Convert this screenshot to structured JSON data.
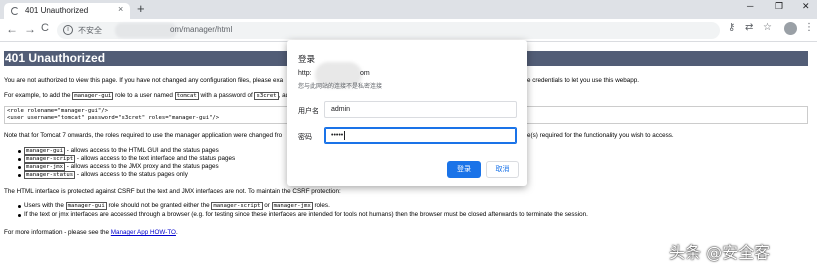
{
  "browser": {
    "tab_title": "401 Unauthorized",
    "tab_close": "×",
    "new_tab": "+",
    "window_controls": {
      "minimize": "─",
      "maximize": "❐",
      "close": "✕"
    },
    "nav": {
      "back": "←",
      "forward": "→",
      "reload": "C"
    },
    "address": {
      "security_label": "不安全",
      "url_visible": "om/manager/html"
    },
    "toolbar_icons": {
      "key": "⚷",
      "translate": "⇄",
      "star": "☆",
      "menu": "⋮"
    }
  },
  "page": {
    "heading": "401 Unauthorized",
    "para1": "You are not authorized to view this page. If you have not changed any configuration files, please exa",
    "para1_tail": "e credentials to let you use this webapp.",
    "para2_pre": "For example, to add the",
    "para2_code1": "manager-gui",
    "para2_mid": "role to a user named",
    "para2_code2": "tomcat",
    "para2_mid2": "with a password of",
    "para2_code3": "s3cret",
    "para2_post": ", add",
    "code_line1": "<role rolename=\"manager-gui\"/>",
    "code_line2": "<user username=\"tomcat\" password=\"s3cret\" roles=\"manager-gui\"/>",
    "para3": "Note that for Tomcat 7 onwards, the roles required to use the manager application were changed fro",
    "para3_tail": "e(s) required for the functionality you wish to access.",
    "roles": [
      {
        "code": "manager-gui",
        "text": "- allows access to the HTML GUI and the status pages"
      },
      {
        "code": "manager-script",
        "text": "- allows access to the text interface and the status pages"
      },
      {
        "code": "manager-jmx",
        "text": "- allows access to the JMX proxy and the status pages"
      },
      {
        "code": "manager-status",
        "text": "- allows access to the status pages only"
      }
    ],
    "para4": "The HTML interface is protected against CSRF but the text and JMX interfaces are not. To maintain the CSRF protection:",
    "csrf1_pre": "Users with the",
    "csrf1_code1": "manager-gui",
    "csrf1_mid": "role should not be granted either the",
    "csrf1_code2": "manager-script",
    "csrf1_or": "or",
    "csrf1_code3": "manager-jmx",
    "csrf1_post": "roles.",
    "csrf2": "If the text or jmx interfaces are accessed through a browser (e.g. for testing since these interfaces are intended for tools not humans) then the browser must be closed afterwards to terminate the session.",
    "more_pre": "For more information - please see the",
    "more_link": "Manager App HOW-TO",
    "more_post": "."
  },
  "dialog": {
    "title": "登录",
    "host_prefix": "http:",
    "host_suffix": "om",
    "note": "您与此网站的连接不是私密连接",
    "username_label": "用户名",
    "username_value": "admin",
    "password_label": "密码",
    "password_value": "•••••",
    "login_button": "登录",
    "cancel_button": "取消"
  },
  "watermark": "头条 @安全客"
}
